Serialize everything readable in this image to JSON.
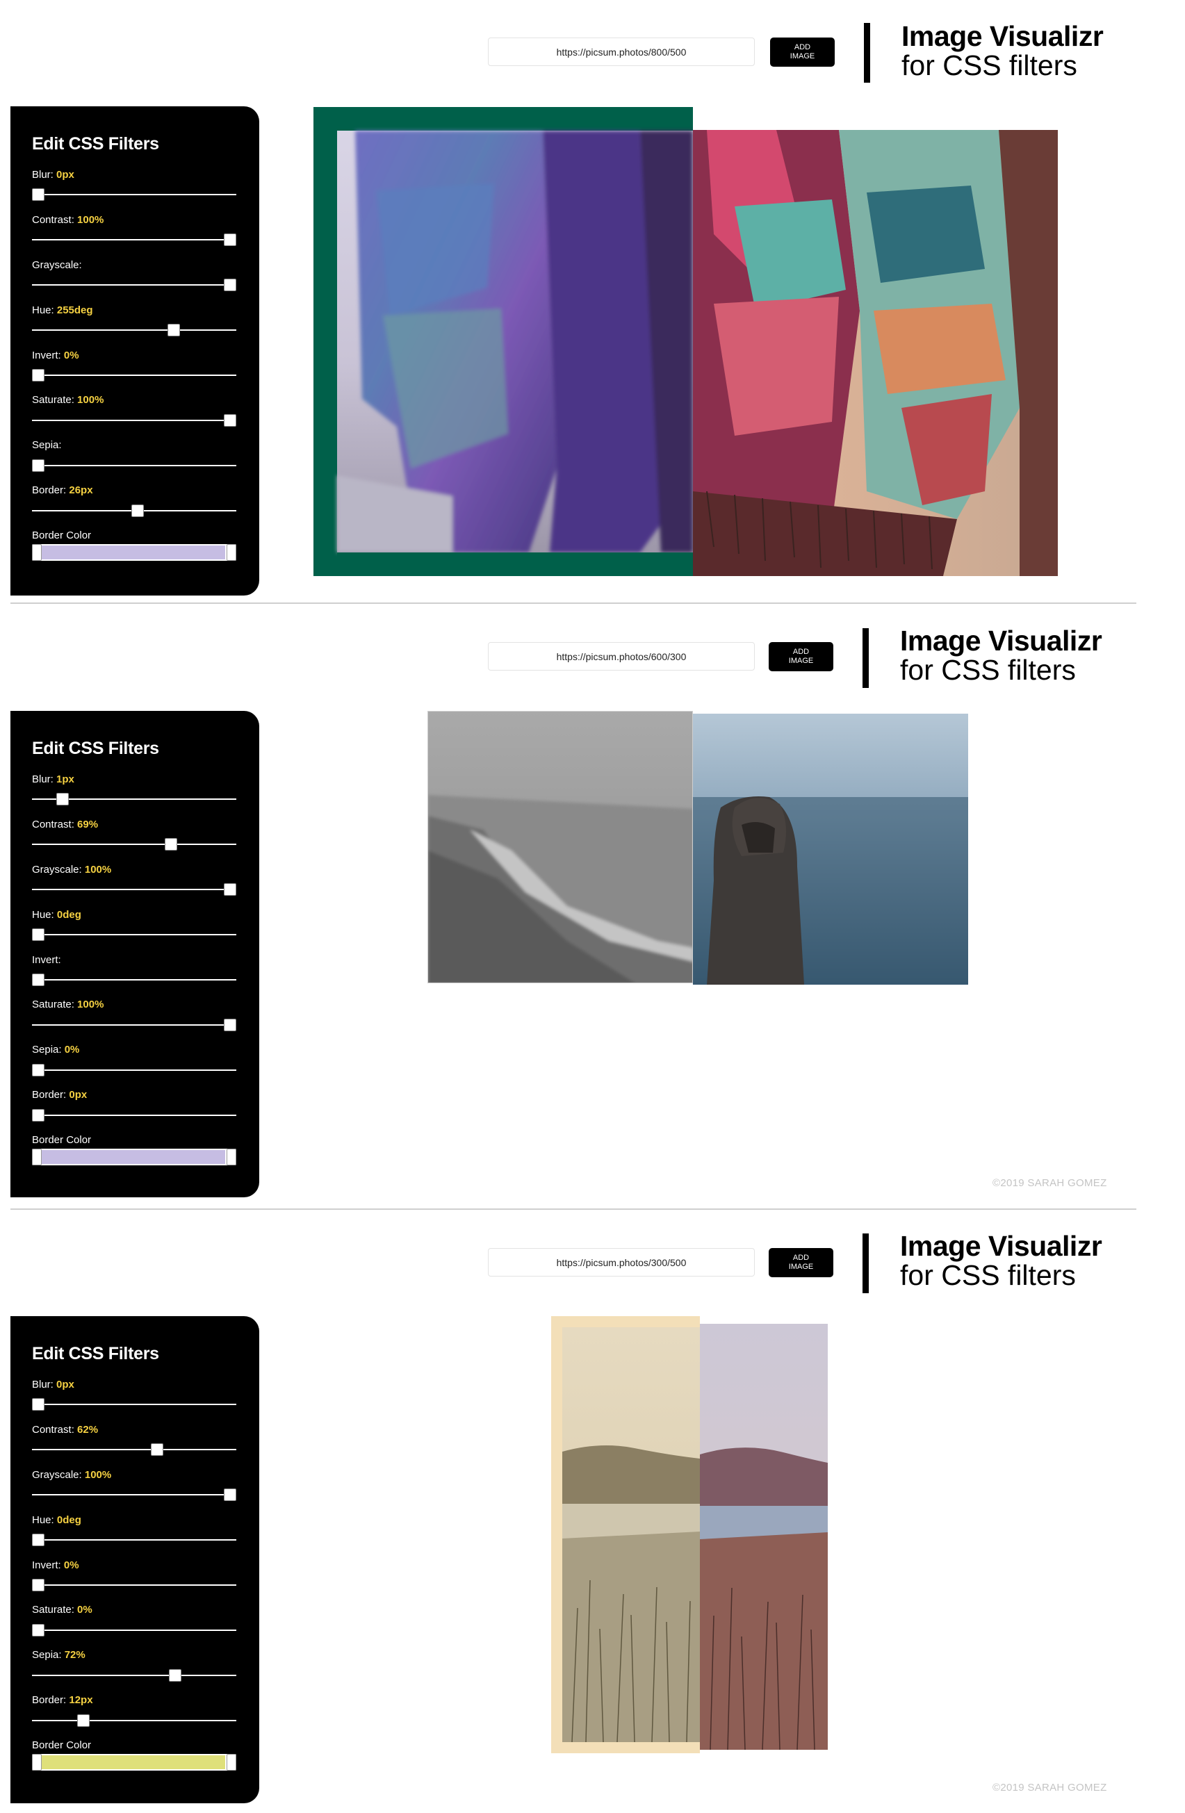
{
  "app": {
    "brand_title": "Image Visualizr",
    "brand_subtitle": "for CSS filters",
    "add_button_label": "ADD\nIMAGE",
    "panel_title": "Edit CSS Filters",
    "footer": "©2019 SARAH GOMEZ",
    "colors": {
      "accent_value": "#f5d142",
      "panel_bg": "#000000"
    }
  },
  "screens": [
    {
      "url": "https://picsum.photos/800/500",
      "controls": {
        "blur": {
          "label": "Blur:",
          "value": "0px",
          "level": 0
        },
        "contrast": {
          "label": "Contrast:",
          "value": "100%",
          "level": 1
        },
        "grayscale": {
          "label": "Grayscale:",
          "value": "",
          "level": 1
        },
        "hue": {
          "label": "Hue:",
          "value": "255deg",
          "level": 0.7
        },
        "invert": {
          "label": "Invert:",
          "value": "0%",
          "level": 0
        },
        "saturate": {
          "label": "Saturate:",
          "value": "100%",
          "level": 1
        },
        "sepia": {
          "label": "Sepia:",
          "value": "",
          "level": 0
        },
        "border": {
          "label": "Border:",
          "value": "26px",
          "level": 0.5
        },
        "border_color": {
          "label": "Border Color",
          "color": "#c6bde3"
        }
      },
      "image_border_color": "#00604a",
      "show_footer": false
    },
    {
      "url": "https://picsum.photos/600/300",
      "controls": {
        "blur": {
          "label": "Blur:",
          "value": "1px",
          "level": 0.12
        },
        "contrast": {
          "label": "Contrast:",
          "value": "69%",
          "level": 0.69
        },
        "grayscale": {
          "label": "Grayscale:",
          "value": "100%",
          "level": 1
        },
        "hue": {
          "label": "Hue:",
          "value": "0deg",
          "level": 0
        },
        "invert": {
          "label": "Invert:",
          "value": "",
          "level": 0
        },
        "saturate": {
          "label": "Saturate:",
          "value": "100%",
          "level": 1
        },
        "sepia": {
          "label": "Sepia:",
          "value": "0%",
          "level": 0
        },
        "border": {
          "label": "Border:",
          "value": "0px",
          "level": 0
        },
        "border_color": {
          "label": "Border Color",
          "color": "#c6bde3"
        }
      },
      "image_border_color": "#cfcfcf",
      "show_footer": true
    },
    {
      "url": "https://picsum.photos/300/500",
      "controls": {
        "blur": {
          "label": "Blur:",
          "value": "0px",
          "level": 0
        },
        "contrast": {
          "label": "Contrast:",
          "value": "62%",
          "level": 0.6
        },
        "grayscale": {
          "label": "Grayscale:",
          "value": "100%",
          "level": 1
        },
        "hue": {
          "label": "Hue:",
          "value": "0deg",
          "level": 0
        },
        "invert": {
          "label": "Invert:",
          "value": "0%",
          "level": 0
        },
        "saturate": {
          "label": "Saturate:",
          "value": "0%",
          "level": 0
        },
        "sepia": {
          "label": "Sepia:",
          "value": "72%",
          "level": 0.72
        },
        "border": {
          "label": "Border:",
          "value": "12px",
          "level": 0.23
        },
        "border_color": {
          "label": "Border Color",
          "color": "#dfe07a"
        }
      },
      "image_border_color": "#f3dfb8",
      "show_footer": true
    }
  ]
}
